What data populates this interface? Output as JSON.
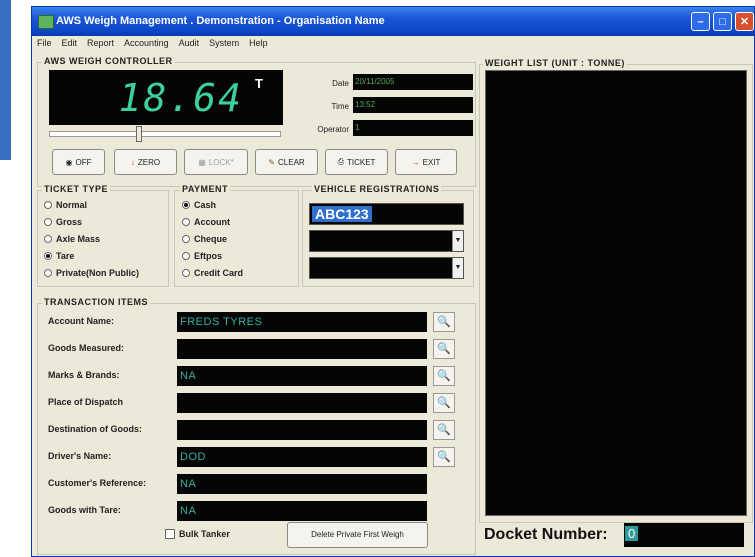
{
  "window": {
    "title": "AWS Weigh Management . Demonstration - Organisation Name",
    "controls": {
      "minimize": "–",
      "maximize": "□",
      "close": "✕"
    }
  },
  "menu": [
    "File",
    "Edit",
    "Report",
    "Accounting",
    "Audit",
    "System",
    "Help"
  ],
  "controller": {
    "label": "AWS WEIGH CONTROLLER",
    "reading": "18.64",
    "unit": "T",
    "slider_level": 0.38,
    "date_label": "Date",
    "date_value": "20/11/2005",
    "time_label": "Time",
    "time_value": "13:52",
    "operator_label": "Operator",
    "operator_value": "1"
  },
  "buttons": {
    "off": "OFF",
    "zero": "ZERO",
    "lock": "LOCK*",
    "clear": "CLEAR",
    "ticket": "TICKET",
    "exit": "EXIT"
  },
  "ticket_type": {
    "label": "TICKET TYPE",
    "options": [
      "Normal",
      "Gross",
      "Axle Mass",
      "Tare",
      "Private(Non Public)"
    ],
    "selected": "Tare"
  },
  "payment": {
    "label": "PAYMENT",
    "options": [
      "Cash",
      "Account",
      "Cheque",
      "Eftpos",
      "Credit Card"
    ],
    "selected": "Cash"
  },
  "vehicle": {
    "label": "VEHICLE REGISTRATIONS",
    "reg1": "ABC123",
    "reg2": "",
    "reg3": ""
  },
  "transaction": {
    "label": "TRANSACTION ITEMS",
    "fields": [
      {
        "label": "Account Name:",
        "value": "FREDS TYRES"
      },
      {
        "label": "Goods Measured:",
        "value": ""
      },
      {
        "label": "Marks & Brands:",
        "value": "NA"
      },
      {
        "label": "Place of Dispatch",
        "value": ""
      },
      {
        "label": "Destination of Goods:",
        "value": ""
      },
      {
        "label": "Driver's Name:",
        "value": "DOD"
      },
      {
        "label": "Customer's Reference:",
        "value": "NA"
      },
      {
        "label": "Goods with Tare:",
        "value": "NA"
      }
    ],
    "bulk_tanker": "Bulk Tanker",
    "delete_button": "Delete Private First Weigh"
  },
  "weight_list": {
    "label": "WEIGHT LIST (UNIT : TONNE)"
  },
  "docket": {
    "label": "Docket Number:",
    "value": "0"
  },
  "colors": {
    "title_bar": "#0b46c8",
    "display_bg": "#050505",
    "digit": "#3ecf9a",
    "field_text": "#38b0a0",
    "vreg_highlight": "#2e6fd0"
  }
}
